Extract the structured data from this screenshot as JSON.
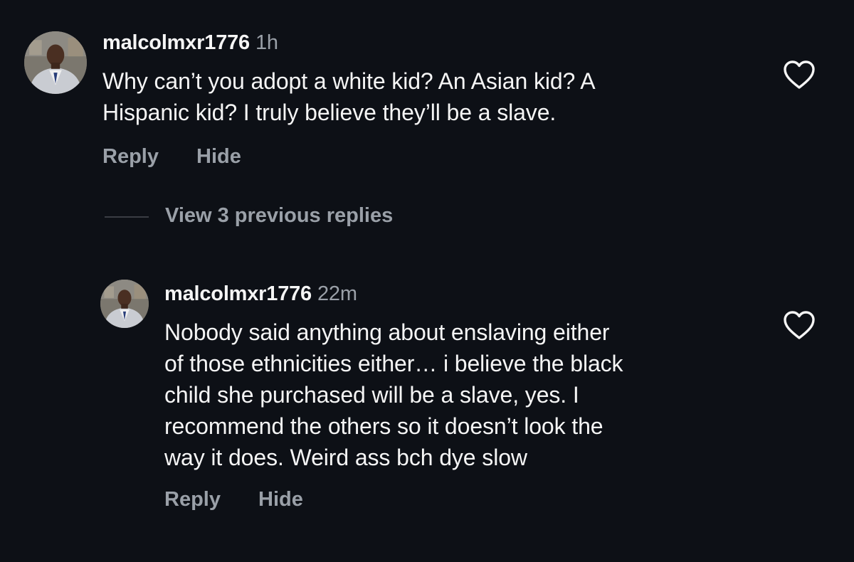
{
  "comment": {
    "username": "malcolmxr1776",
    "time": "1h",
    "lines": [
      "Why can’t you adopt a white kid? An Asian kid? A",
      "Hispanic kid? I truly believe they’ll be a slave."
    ],
    "reply_label": "Reply",
    "hide_label": "Hide",
    "like_icon": "heart-outline-icon"
  },
  "view_replies_label": "View 3 previous replies",
  "reply": {
    "username": "malcolmxr1776",
    "time": "22m",
    "lines": [
      "Nobody said anything about enslaving either",
      "of those ethnicities either… i believe the black",
      "child she purchased will be a slave, yes. I",
      "recommend the others so it doesn’t look the",
      "way it does. Weird ass bch dye slow"
    ],
    "reply_label": "Reply",
    "hide_label": "Hide",
    "like_icon": "heart-outline-icon"
  },
  "colors": {
    "background": "#0d1016",
    "text_primary": "#f5f5f5",
    "text_secondary": "#9aa0a8"
  }
}
